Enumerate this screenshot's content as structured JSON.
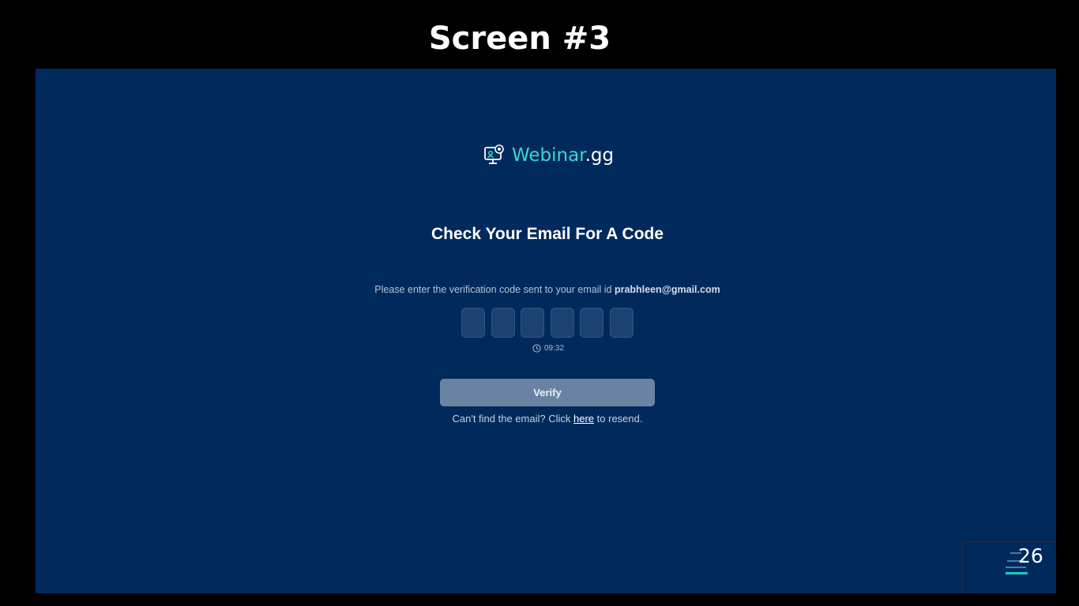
{
  "slide": {
    "title": "Screen #3",
    "page_number": "26"
  },
  "colors": {
    "background": "#000000",
    "screen_background": "#002a5c",
    "brand_accent": "#3ed6d0",
    "button_disabled": "#6b83a3"
  },
  "logo": {
    "icon": "webinar-monitor-icon",
    "name_accent": "Webinar",
    "name_suffix": ".gg"
  },
  "verification": {
    "heading": "Check Your Email For A Code",
    "instruction": "Please enter the verification code sent to your email id",
    "email": "prabhleen@gmail.com",
    "code_length": 6,
    "timer_icon": "clock-icon",
    "timer": "09:32",
    "verify_label": "Verify",
    "resend_prefix": "Can't find the email? Click",
    "resend_link": "here",
    "resend_suffix": "to resend."
  }
}
